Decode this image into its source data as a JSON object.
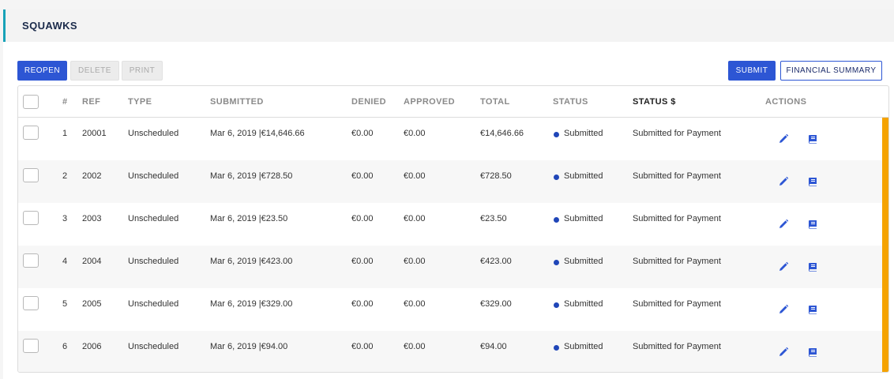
{
  "section": {
    "title": "SQUAWKS"
  },
  "toolbar": {
    "reopen_label": "REOPEN",
    "delete_label": "DELETE",
    "print_label": "PRINT",
    "submit_label": "SUBMIT",
    "financial_summary_label": "FINANCIAL SUMMARY"
  },
  "table": {
    "columns": {
      "num": "#",
      "ref": "REF",
      "type": "TYPE",
      "submitted": "SUBMITTED",
      "denied": "DENIED",
      "approved": "APPROVED",
      "total": "TOTAL",
      "status": "STATUS",
      "status_dollar": "STATUS $",
      "actions": "ACTIONS"
    },
    "rows": [
      {
        "num": "1",
        "ref": "20001",
        "type": "Unscheduled",
        "submitted": "Mar 6, 2019 |€14,646.66",
        "denied": "€0.00",
        "approved": "€0.00",
        "total": "€14,646.66",
        "status": "Submitted",
        "status_dollar": "Submitted for Payment"
      },
      {
        "num": "2",
        "ref": "2002",
        "type": "Unscheduled",
        "submitted": "Mar 6, 2019 |€728.50",
        "denied": "€0.00",
        "approved": "€0.00",
        "total": "€728.50",
        "status": "Submitted",
        "status_dollar": "Submitted for Payment"
      },
      {
        "num": "3",
        "ref": "2003",
        "type": "Unscheduled",
        "submitted": "Mar 6, 2019 |€23.50",
        "denied": "€0.00",
        "approved": "€0.00",
        "total": "€23.50",
        "status": "Submitted",
        "status_dollar": "Submitted for Payment"
      },
      {
        "num": "4",
        "ref": "2004",
        "type": "Unscheduled",
        "submitted": "Mar 6, 2019 |€423.00",
        "denied": "€0.00",
        "approved": "€0.00",
        "total": "€423.00",
        "status": "Submitted",
        "status_dollar": "Submitted for Payment"
      },
      {
        "num": "5",
        "ref": "2005",
        "type": "Unscheduled",
        "submitted": "Mar 6, 2019 |€329.00",
        "denied": "€0.00",
        "approved": "€0.00",
        "total": "€329.00",
        "status": "Submitted",
        "status_dollar": "Submitted for Payment"
      },
      {
        "num": "6",
        "ref": "2006",
        "type": "Unscheduled",
        "submitted": "Mar 6, 2019 |€94.00",
        "denied": "€0.00",
        "approved": "€0.00",
        "total": "€94.00",
        "status": "Submitted",
        "status_dollar": "Submitted for Payment"
      }
    ]
  },
  "icons": {
    "edit": "pencil-icon",
    "view": "book-icon"
  },
  "colors": {
    "primary": "#2d56d4",
    "accent_bar": "#f5a300",
    "header_accent": "#17a2b8",
    "status_dot": "#2046b8"
  }
}
